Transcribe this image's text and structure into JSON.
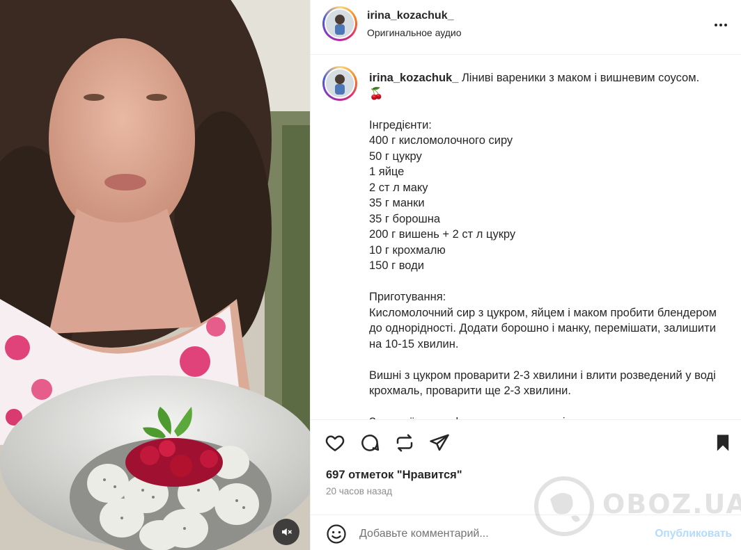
{
  "post": {
    "username": "irina_kozachuk_",
    "audio": "Оригинальное аудио",
    "caption_text": " Ліниві вареники з маком і вишневим соусом.\n🍒\n\nІнгредієнти:\n400 г кисломолочного сиру\n50 г цукру\n1 яйце\n2 ст л маку\n35 г манки\n35 г борошна\n200 г вишень + 2 ст л цукру\n10 г крохмалю\n150 г води\n\nПриготування:\nКисломолочний сир з цукром, яйцем і маком пробити блендером до однорідності. Додати борошно і манку, перемішати, залишити на 10-15 хвилин.\n\nВишні з цукром проварити 2-3 хвилини і влити розведений у воді крохмаль, проварити ще 2-3 хвилини.\n\nЗ сирної маси сформувати кульки, відварити",
    "likes": "697 отметок \"Нравится\"",
    "time": "20 часов назад"
  },
  "comment": {
    "placeholder": "Добавьте комментарий...",
    "post_label": "Опубликовать"
  },
  "watermark": {
    "text": "OBOZ.UA"
  },
  "icons": {
    "more": "more-options-icon",
    "like": "heart-icon",
    "comment": "comment-icon",
    "repost": "repost-icon",
    "share": "share-icon",
    "save": "bookmark-icon",
    "emoji": "emoji-icon",
    "mute": "sound-off-icon"
  },
  "colors": {
    "text": "#262626",
    "muted": "#8e8e8e",
    "link": "#b3dbff",
    "divider": "#efefef"
  }
}
